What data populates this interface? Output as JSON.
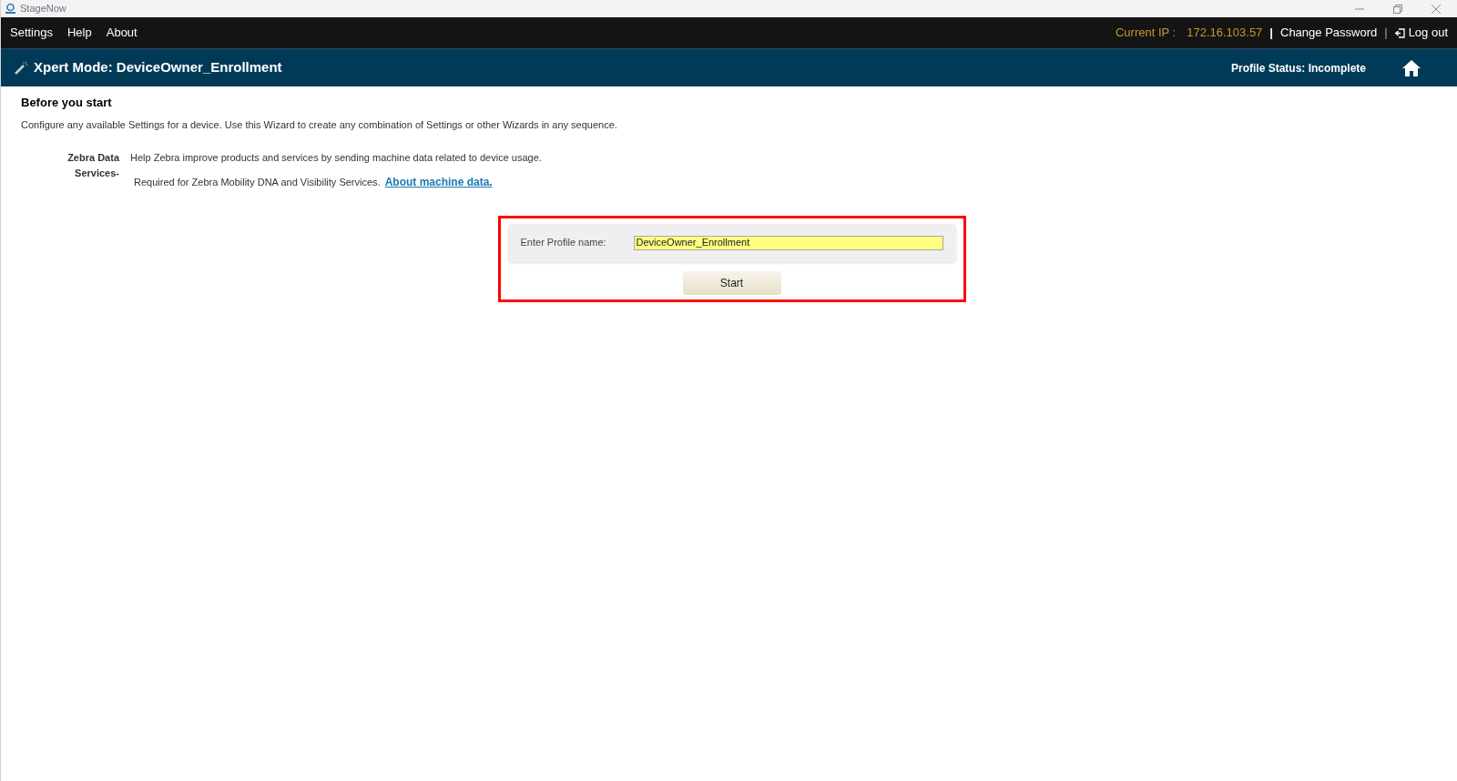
{
  "window": {
    "title": "StageNow"
  },
  "menu": [
    "Settings",
    "Help",
    "About"
  ],
  "top_right": {
    "ip_label": "Current IP :",
    "ip_value": "172.16.103.57",
    "separator_1": "|",
    "change_password": "Change Password",
    "separator_2": "|",
    "log_out": "Log out"
  },
  "header": {
    "title": "Xpert Mode: DeviceOwner_Enrollment",
    "profile_status": "Profile Status: Incomplete"
  },
  "intro": {
    "heading": "Before you start",
    "text": "Configure any available Settings for a device. Use this Wizard to create any combination of Settings or other Wizards in any sequence."
  },
  "data_services": {
    "label": "Zebra Data Services-",
    "line_1": "Help Zebra improve products and services by sending machine data related to device usage.",
    "line_2": "Required for Zebra Mobility DNA and Visibility Services.",
    "link": "About machine data."
  },
  "profile_form": {
    "label": "Enter Profile name:",
    "value": "DeviceOwner_Enrollment",
    "button": "Start"
  }
}
